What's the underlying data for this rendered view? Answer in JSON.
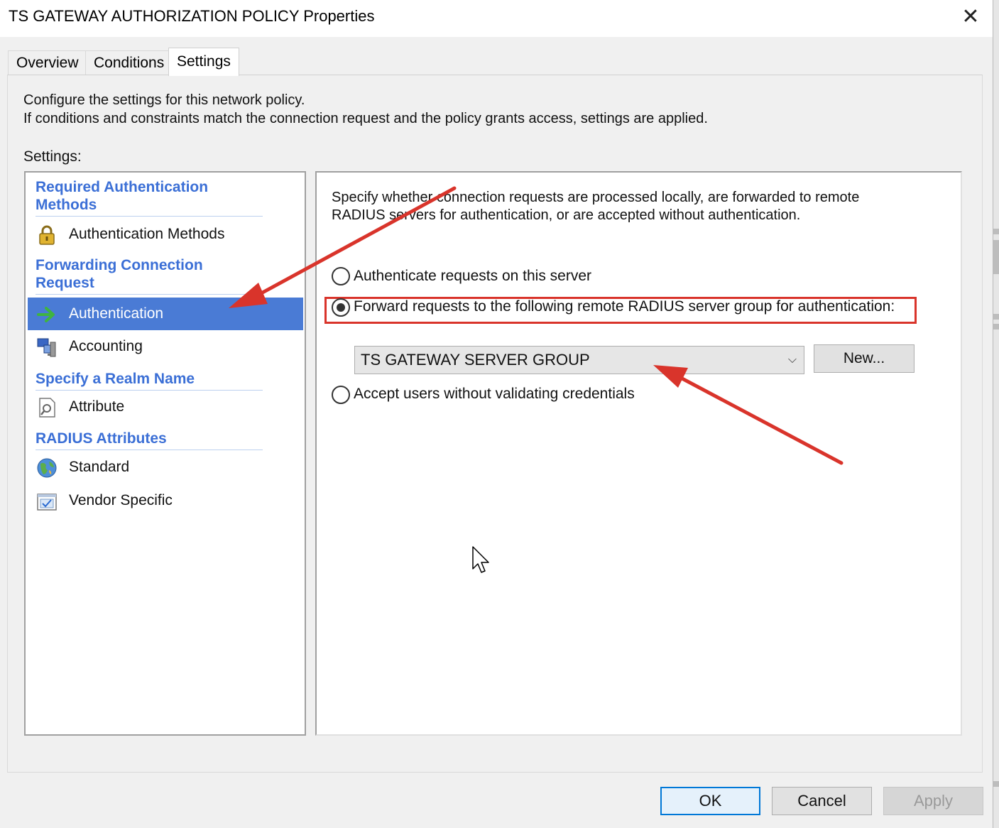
{
  "window": {
    "title": "TS GATEWAY AUTHORIZATION POLICY Properties",
    "close_glyph": "✕"
  },
  "tabs": [
    {
      "label": "Overview",
      "active": false
    },
    {
      "label": "Conditions",
      "active": false
    },
    {
      "label": "Settings",
      "active": true
    }
  ],
  "settings_tab": {
    "description_line1": "Configure the settings for this network policy.",
    "description_line2": "If conditions and constraints match the connection request and the policy grants access, settings are applied.",
    "settings_label": "Settings:"
  },
  "left_list": {
    "groups": [
      {
        "header": "Required Authentication Methods",
        "items": [
          {
            "label": "Authentication Methods",
            "icon": "lock-icon"
          }
        ]
      },
      {
        "header": "Forwarding Connection Request",
        "items": [
          {
            "label": "Authentication",
            "icon": "green-arrow-icon",
            "selected": true
          },
          {
            "label": "Accounting",
            "icon": "computers-icon"
          }
        ]
      },
      {
        "header": "Specify a Realm Name",
        "items": [
          {
            "label": "Attribute",
            "icon": "document-magnifier-icon"
          }
        ]
      },
      {
        "header": "RADIUS Attributes",
        "items": [
          {
            "label": "Standard",
            "icon": "globe-icon"
          },
          {
            "label": "Vendor Specific",
            "icon": "checkbox-window-icon"
          }
        ]
      }
    ]
  },
  "right_panel": {
    "description_line1": "Specify whether connection requests are processed locally, are forwarded to remote",
    "description_line2": "RADIUS servers for authentication, or are accepted without authentication.",
    "options": [
      {
        "label": "Authenticate requests on this server",
        "checked": false
      },
      {
        "label": "Forward requests to the following remote RADIUS server group for authentication:",
        "checked": true
      },
      {
        "label": "Accept users without validating credentials",
        "checked": false
      }
    ],
    "server_group": {
      "selected": "TS GATEWAY SERVER GROUP",
      "arrow_glyph": "⌵"
    },
    "new_button": "New..."
  },
  "footer_buttons": {
    "ok": "OK",
    "cancel": "Cancel",
    "apply": "Apply"
  },
  "colors": {
    "selection": "#4a7bd5",
    "group_header": "#3b6fd6",
    "annotation_red": "#d9342b"
  }
}
